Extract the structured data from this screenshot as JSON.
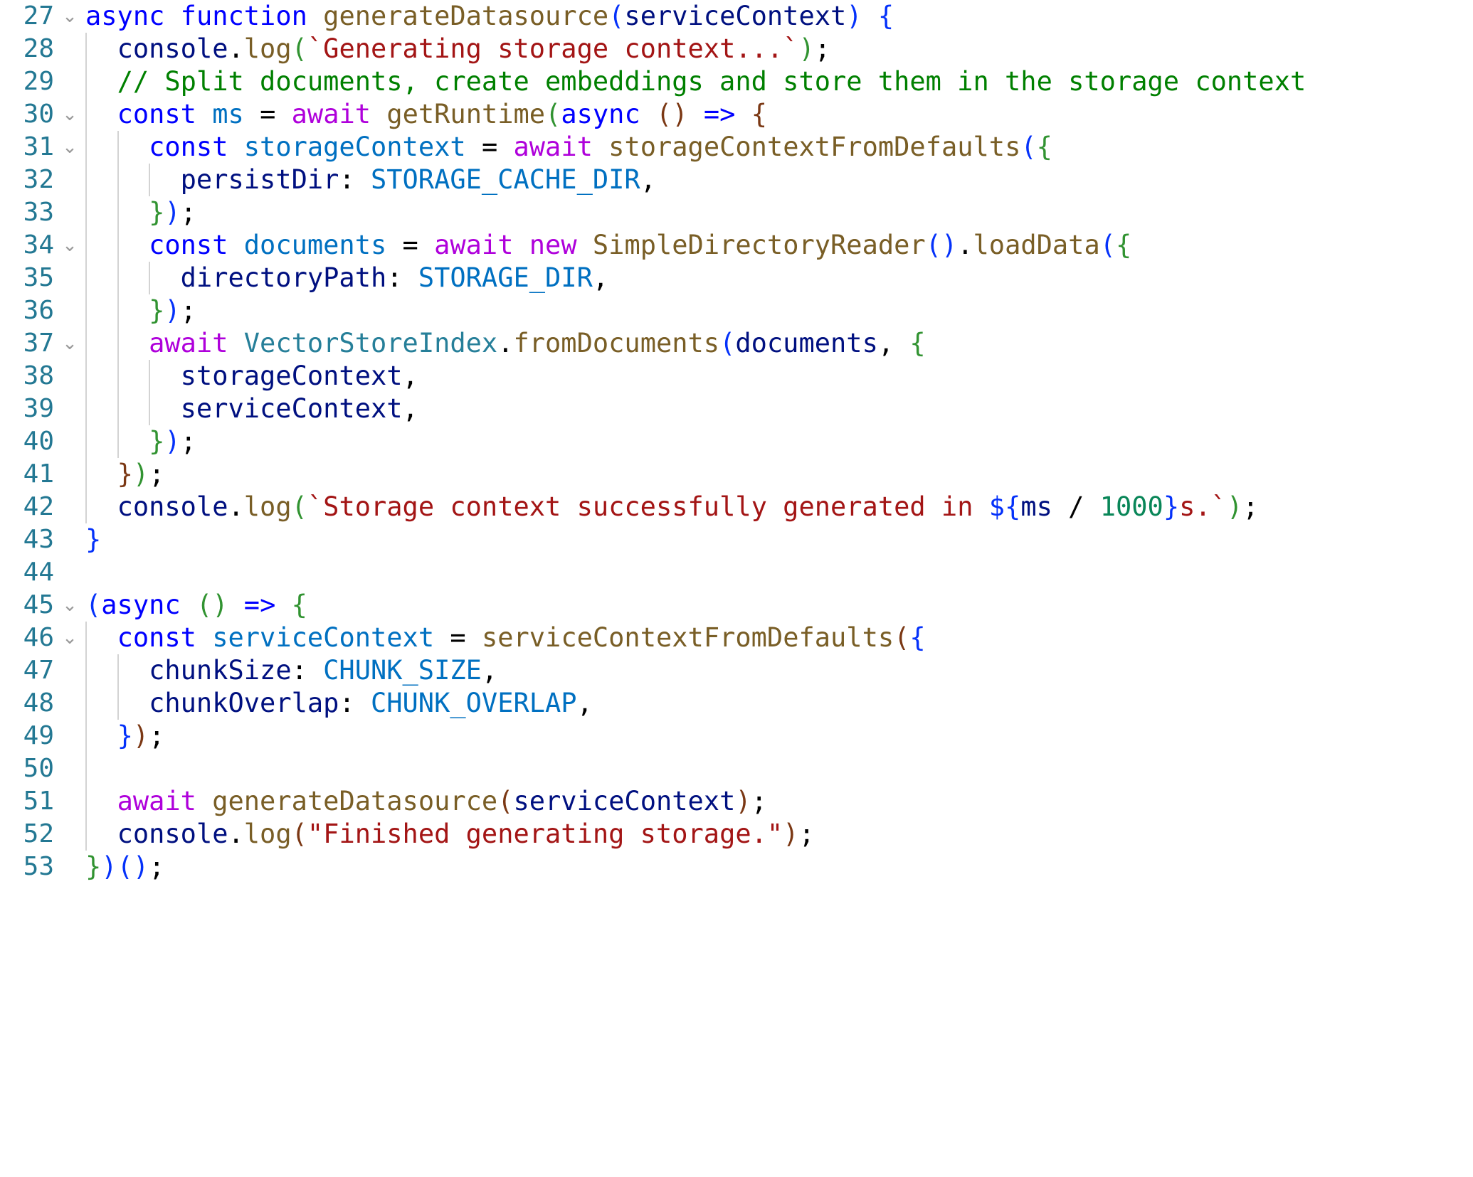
{
  "editor": {
    "language": "javascript",
    "theme": "light-plus",
    "first_line": 27,
    "last_line": 53,
    "colors": {
      "background": "#ffffff",
      "line_number": "#237893",
      "indent_guide": "#d3d3d3",
      "keyword": "#0000ff",
      "control_keyword": "#af00db",
      "function": "#795e26",
      "variable": "#0070c1",
      "property": "#001080",
      "class": "#267f99",
      "string": "#a31515",
      "comment": "#008000",
      "number": "#098658",
      "bracket_1": "#0431fa",
      "bracket_2": "#319331",
      "bracket_3": "#7b3814"
    },
    "fold_chevron_glyph": "⌄"
  },
  "lines": [
    {
      "number": "27",
      "fold": "⌄",
      "guides": 0,
      "text": "async function generateDatasource(serviceContext) {",
      "tokens": [
        {
          "t": "async",
          "c": "kw"
        },
        {
          "t": " ",
          "c": "plain"
        },
        {
          "t": "function",
          "c": "kw"
        },
        {
          "t": " ",
          "c": "plain"
        },
        {
          "t": "generateDatasource",
          "c": "fn"
        },
        {
          "t": "(",
          "c": "b1"
        },
        {
          "t": "serviceContext",
          "c": "prop"
        },
        {
          "t": ")",
          "c": "b1"
        },
        {
          "t": " ",
          "c": "plain"
        },
        {
          "t": "{",
          "c": "b1"
        }
      ]
    },
    {
      "number": "28",
      "fold": "",
      "guides": 1,
      "text": "  console.log(`Generating storage context...`);",
      "tokens": [
        {
          "t": "  ",
          "c": "plain"
        },
        {
          "t": "console",
          "c": "prop"
        },
        {
          "t": ".",
          "c": "plain"
        },
        {
          "t": "log",
          "c": "fn"
        },
        {
          "t": "(",
          "c": "b2"
        },
        {
          "t": "`Generating storage context...`",
          "c": "str"
        },
        {
          "t": ")",
          "c": "b2"
        },
        {
          "t": ";",
          "c": "plain"
        }
      ]
    },
    {
      "number": "29",
      "fold": "",
      "guides": 1,
      "text": "  // Split documents, create embeddings and store them in the storage context",
      "tokens": [
        {
          "t": "  ",
          "c": "plain"
        },
        {
          "t": "// Split documents, create embeddings and store them in the storage context",
          "c": "cmt"
        }
      ]
    },
    {
      "number": "30",
      "fold": "⌄",
      "guides": 1,
      "text": "  const ms = await getRuntime(async () => {",
      "tokens": [
        {
          "t": "  ",
          "c": "plain"
        },
        {
          "t": "const",
          "c": "kw"
        },
        {
          "t": " ",
          "c": "plain"
        },
        {
          "t": "ms",
          "c": "var"
        },
        {
          "t": " ",
          "c": "plain"
        },
        {
          "t": "=",
          "c": "plain"
        },
        {
          "t": " ",
          "c": "plain"
        },
        {
          "t": "await",
          "c": "ctrl"
        },
        {
          "t": " ",
          "c": "plain"
        },
        {
          "t": "getRuntime",
          "c": "fn"
        },
        {
          "t": "(",
          "c": "b2"
        },
        {
          "t": "async",
          "c": "kw"
        },
        {
          "t": " ",
          "c": "plain"
        },
        {
          "t": "(",
          "c": "b3"
        },
        {
          "t": ")",
          "c": "b3"
        },
        {
          "t": " ",
          "c": "plain"
        },
        {
          "t": "=>",
          "c": "kw"
        },
        {
          "t": " ",
          "c": "plain"
        },
        {
          "t": "{",
          "c": "b3"
        }
      ]
    },
    {
      "number": "31",
      "fold": "⌄",
      "guides": 2,
      "text": "    const storageContext = await storageContextFromDefaults({",
      "tokens": [
        {
          "t": "    ",
          "c": "plain"
        },
        {
          "t": "const",
          "c": "kw"
        },
        {
          "t": " ",
          "c": "plain"
        },
        {
          "t": "storageContext",
          "c": "var"
        },
        {
          "t": " ",
          "c": "plain"
        },
        {
          "t": "=",
          "c": "plain"
        },
        {
          "t": " ",
          "c": "plain"
        },
        {
          "t": "await",
          "c": "ctrl"
        },
        {
          "t": " ",
          "c": "plain"
        },
        {
          "t": "storageContextFromDefaults",
          "c": "fn"
        },
        {
          "t": "(",
          "c": "b1"
        },
        {
          "t": "{",
          "c": "b2"
        }
      ]
    },
    {
      "number": "32",
      "fold": "",
      "guides": 3,
      "text": "      persistDir: STORAGE_CACHE_DIR,",
      "tokens": [
        {
          "t": "      ",
          "c": "plain"
        },
        {
          "t": "persistDir",
          "c": "prop"
        },
        {
          "t": ":",
          "c": "plain"
        },
        {
          "t": " ",
          "c": "plain"
        },
        {
          "t": "STORAGE_CACHE_DIR",
          "c": "var"
        },
        {
          "t": ",",
          "c": "plain"
        }
      ]
    },
    {
      "number": "33",
      "fold": "",
      "guides": 2,
      "text": "    });",
      "tokens": [
        {
          "t": "    ",
          "c": "plain"
        },
        {
          "t": "}",
          "c": "b2"
        },
        {
          "t": ")",
          "c": "b1"
        },
        {
          "t": ";",
          "c": "plain"
        }
      ]
    },
    {
      "number": "34",
      "fold": "⌄",
      "guides": 2,
      "text": "    const documents = await new SimpleDirectoryReader().loadData({",
      "tokens": [
        {
          "t": "    ",
          "c": "plain"
        },
        {
          "t": "const",
          "c": "kw"
        },
        {
          "t": " ",
          "c": "plain"
        },
        {
          "t": "documents",
          "c": "var"
        },
        {
          "t": " ",
          "c": "plain"
        },
        {
          "t": "=",
          "c": "plain"
        },
        {
          "t": " ",
          "c": "plain"
        },
        {
          "t": "await",
          "c": "ctrl"
        },
        {
          "t": " ",
          "c": "plain"
        },
        {
          "t": "new",
          "c": "ctrl"
        },
        {
          "t": " ",
          "c": "plain"
        },
        {
          "t": "SimpleDirectoryReader",
          "c": "fn"
        },
        {
          "t": "(",
          "c": "b1"
        },
        {
          "t": ")",
          "c": "b1"
        },
        {
          "t": ".",
          "c": "plain"
        },
        {
          "t": "loadData",
          "c": "fn"
        },
        {
          "t": "(",
          "c": "b1"
        },
        {
          "t": "{",
          "c": "b2"
        }
      ]
    },
    {
      "number": "35",
      "fold": "",
      "guides": 3,
      "text": "      directoryPath: STORAGE_DIR,",
      "tokens": [
        {
          "t": "      ",
          "c": "plain"
        },
        {
          "t": "directoryPath",
          "c": "prop"
        },
        {
          "t": ":",
          "c": "plain"
        },
        {
          "t": " ",
          "c": "plain"
        },
        {
          "t": "STORAGE_DIR",
          "c": "var"
        },
        {
          "t": ",",
          "c": "plain"
        }
      ]
    },
    {
      "number": "36",
      "fold": "",
      "guides": 2,
      "text": "    });",
      "tokens": [
        {
          "t": "    ",
          "c": "plain"
        },
        {
          "t": "}",
          "c": "b2"
        },
        {
          "t": ")",
          "c": "b1"
        },
        {
          "t": ";",
          "c": "plain"
        }
      ]
    },
    {
      "number": "37",
      "fold": "⌄",
      "guides": 2,
      "text": "    await VectorStoreIndex.fromDocuments(documents, {",
      "tokens": [
        {
          "t": "    ",
          "c": "plain"
        },
        {
          "t": "await",
          "c": "ctrl"
        },
        {
          "t": " ",
          "c": "plain"
        },
        {
          "t": "VectorStoreIndex",
          "c": "cls"
        },
        {
          "t": ".",
          "c": "plain"
        },
        {
          "t": "fromDocuments",
          "c": "fn"
        },
        {
          "t": "(",
          "c": "b1"
        },
        {
          "t": "documents",
          "c": "prop"
        },
        {
          "t": ",",
          "c": "plain"
        },
        {
          "t": " ",
          "c": "plain"
        },
        {
          "t": "{",
          "c": "b2"
        }
      ]
    },
    {
      "number": "38",
      "fold": "",
      "guides": 3,
      "text": "      storageContext,",
      "tokens": [
        {
          "t": "      ",
          "c": "plain"
        },
        {
          "t": "storageContext",
          "c": "prop"
        },
        {
          "t": ",",
          "c": "plain"
        }
      ]
    },
    {
      "number": "39",
      "fold": "",
      "guides": 3,
      "text": "      serviceContext,",
      "tokens": [
        {
          "t": "      ",
          "c": "plain"
        },
        {
          "t": "serviceContext",
          "c": "prop"
        },
        {
          "t": ",",
          "c": "plain"
        }
      ]
    },
    {
      "number": "40",
      "fold": "",
      "guides": 2,
      "text": "    });",
      "tokens": [
        {
          "t": "    ",
          "c": "plain"
        },
        {
          "t": "}",
          "c": "b2"
        },
        {
          "t": ")",
          "c": "b1"
        },
        {
          "t": ";",
          "c": "plain"
        }
      ]
    },
    {
      "number": "41",
      "fold": "",
      "guides": 1,
      "text": "  });",
      "tokens": [
        {
          "t": "  ",
          "c": "plain"
        },
        {
          "t": "}",
          "c": "b3"
        },
        {
          "t": ")",
          "c": "b2"
        },
        {
          "t": ";",
          "c": "plain"
        }
      ]
    },
    {
      "number": "42",
      "fold": "",
      "guides": 1,
      "text": "  console.log(`Storage context successfully generated in ${ms / 1000}s.`);",
      "tokens": [
        {
          "t": "  ",
          "c": "plain"
        },
        {
          "t": "console",
          "c": "prop"
        },
        {
          "t": ".",
          "c": "plain"
        },
        {
          "t": "log",
          "c": "fn"
        },
        {
          "t": "(",
          "c": "b2"
        },
        {
          "t": "`Storage context successfully generated in ",
          "c": "str"
        },
        {
          "t": "${",
          "c": "b1"
        },
        {
          "t": "ms",
          "c": "prop"
        },
        {
          "t": " ",
          "c": "plain"
        },
        {
          "t": "/",
          "c": "plain"
        },
        {
          "t": " ",
          "c": "plain"
        },
        {
          "t": "1000",
          "c": "num"
        },
        {
          "t": "}",
          "c": "b1"
        },
        {
          "t": "s.`",
          "c": "str"
        },
        {
          "t": ")",
          "c": "b2"
        },
        {
          "t": ";",
          "c": "plain"
        }
      ]
    },
    {
      "number": "43",
      "fold": "",
      "guides": 0,
      "text": "}",
      "tokens": [
        {
          "t": "}",
          "c": "b1"
        }
      ]
    },
    {
      "number": "44",
      "fold": "",
      "guides": 0,
      "text": "",
      "tokens": []
    },
    {
      "number": "45",
      "fold": "⌄",
      "guides": 0,
      "text": "(async () => {",
      "tokens": [
        {
          "t": "(",
          "c": "b1"
        },
        {
          "t": "async",
          "c": "kw"
        },
        {
          "t": " ",
          "c": "plain"
        },
        {
          "t": "(",
          "c": "b2"
        },
        {
          "t": ")",
          "c": "b2"
        },
        {
          "t": " ",
          "c": "plain"
        },
        {
          "t": "=>",
          "c": "kw"
        },
        {
          "t": " ",
          "c": "plain"
        },
        {
          "t": "{",
          "c": "b2"
        }
      ]
    },
    {
      "number": "46",
      "fold": "⌄",
      "guides": 1,
      "text": "  const serviceContext = serviceContextFromDefaults({",
      "tokens": [
        {
          "t": "  ",
          "c": "plain"
        },
        {
          "t": "const",
          "c": "kw"
        },
        {
          "t": " ",
          "c": "plain"
        },
        {
          "t": "serviceContext",
          "c": "var"
        },
        {
          "t": " ",
          "c": "plain"
        },
        {
          "t": "=",
          "c": "plain"
        },
        {
          "t": " ",
          "c": "plain"
        },
        {
          "t": "serviceContextFromDefaults",
          "c": "fn"
        },
        {
          "t": "(",
          "c": "b3"
        },
        {
          "t": "{",
          "c": "b1"
        }
      ]
    },
    {
      "number": "47",
      "fold": "",
      "guides": 2,
      "text": "    chunkSize: CHUNK_SIZE,",
      "tokens": [
        {
          "t": "    ",
          "c": "plain"
        },
        {
          "t": "chunkSize",
          "c": "prop"
        },
        {
          "t": ":",
          "c": "plain"
        },
        {
          "t": " ",
          "c": "plain"
        },
        {
          "t": "CHUNK_SIZE",
          "c": "var"
        },
        {
          "t": ",",
          "c": "plain"
        }
      ]
    },
    {
      "number": "48",
      "fold": "",
      "guides": 2,
      "text": "    chunkOverlap: CHUNK_OVERLAP,",
      "tokens": [
        {
          "t": "    ",
          "c": "plain"
        },
        {
          "t": "chunkOverlap",
          "c": "prop"
        },
        {
          "t": ":",
          "c": "plain"
        },
        {
          "t": " ",
          "c": "plain"
        },
        {
          "t": "CHUNK_OVERLAP",
          "c": "var"
        },
        {
          "t": ",",
          "c": "plain"
        }
      ]
    },
    {
      "number": "49",
      "fold": "",
      "guides": 1,
      "text": "  });",
      "tokens": [
        {
          "t": "  ",
          "c": "plain"
        },
        {
          "t": "}",
          "c": "b1"
        },
        {
          "t": ")",
          "c": "b3"
        },
        {
          "t": ";",
          "c": "plain"
        }
      ]
    },
    {
      "number": "50",
      "fold": "",
      "guides": 1,
      "text": "",
      "tokens": []
    },
    {
      "number": "51",
      "fold": "",
      "guides": 1,
      "text": "  await generateDatasource(serviceContext);",
      "tokens": [
        {
          "t": "  ",
          "c": "plain"
        },
        {
          "t": "await",
          "c": "ctrl"
        },
        {
          "t": " ",
          "c": "plain"
        },
        {
          "t": "generateDatasource",
          "c": "fn"
        },
        {
          "t": "(",
          "c": "b3"
        },
        {
          "t": "serviceContext",
          "c": "prop"
        },
        {
          "t": ")",
          "c": "b3"
        },
        {
          "t": ";",
          "c": "plain"
        }
      ]
    },
    {
      "number": "52",
      "fold": "",
      "guides": 1,
      "text": "  console.log(\"Finished generating storage.\");",
      "tokens": [
        {
          "t": "  ",
          "c": "plain"
        },
        {
          "t": "console",
          "c": "prop"
        },
        {
          "t": ".",
          "c": "plain"
        },
        {
          "t": "log",
          "c": "fn"
        },
        {
          "t": "(",
          "c": "b3"
        },
        {
          "t": "\"Finished generating storage.\"",
          "c": "str"
        },
        {
          "t": ")",
          "c": "b3"
        },
        {
          "t": ";",
          "c": "plain"
        }
      ]
    },
    {
      "number": "53",
      "fold": "",
      "guides": 0,
      "text": "})();",
      "tokens": [
        {
          "t": "}",
          "c": "b2"
        },
        {
          "t": ")",
          "c": "b1"
        },
        {
          "t": "(",
          "c": "b1"
        },
        {
          "t": ")",
          "c": "b1"
        },
        {
          "t": ";",
          "c": "plain"
        }
      ]
    }
  ]
}
